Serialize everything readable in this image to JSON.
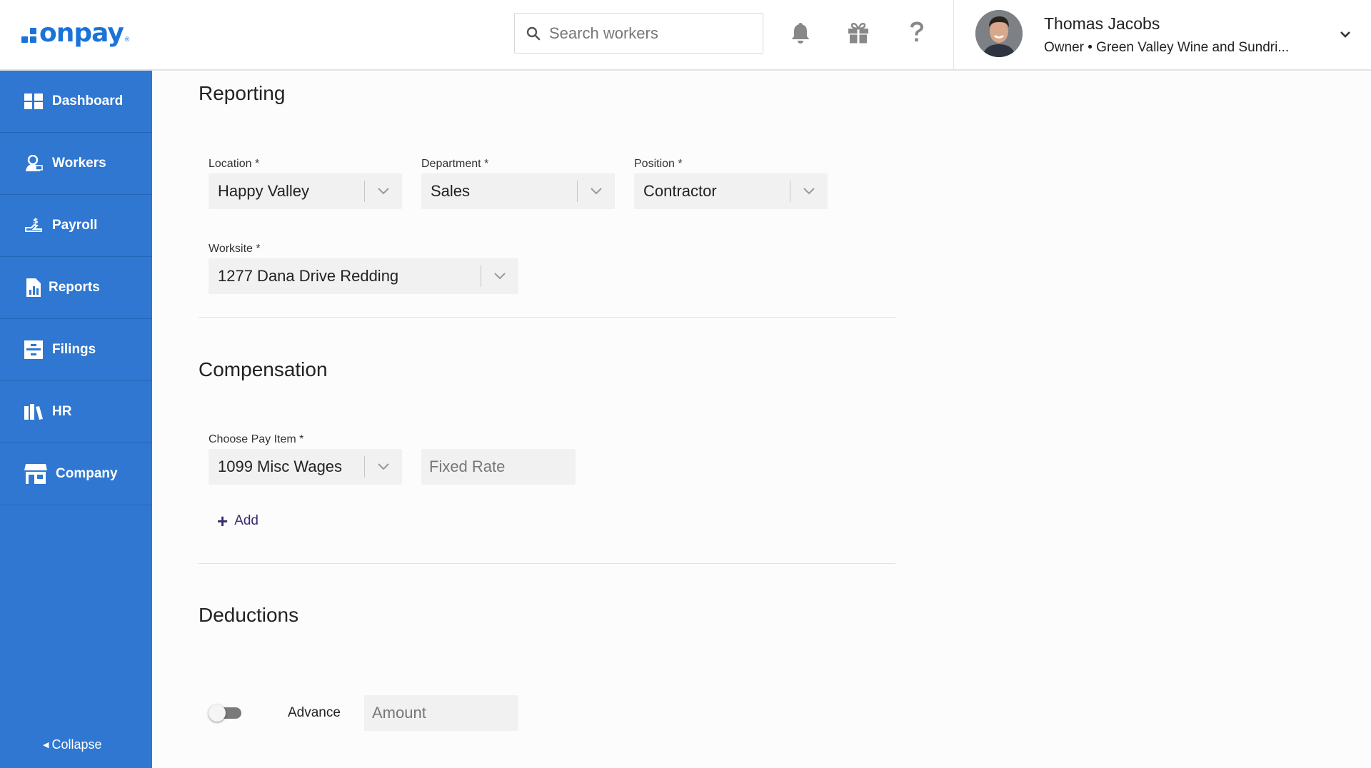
{
  "brand": {
    "logo_text": "onpay",
    "logo_reg": "®",
    "accent": "#2f77d0"
  },
  "search": {
    "placeholder": "Search workers",
    "icon": "search-icon"
  },
  "header_icons": [
    "bell-icon",
    "gift-icon",
    "help-icon"
  ],
  "user": {
    "name": "Thomas Jacobs",
    "subtitle": "Owner • Green Valley Wine and Sundri..."
  },
  "sidebar": {
    "items": [
      {
        "label": "Dashboard",
        "icon": "dashboard-icon"
      },
      {
        "label": "Workers",
        "icon": "workers-icon"
      },
      {
        "label": "Payroll",
        "icon": "payroll-icon"
      },
      {
        "label": "Reports",
        "icon": "reports-icon"
      },
      {
        "label": "Filings",
        "icon": "filings-icon"
      },
      {
        "label": "HR",
        "icon": "hr-icon"
      },
      {
        "label": "Company",
        "icon": "company-icon"
      }
    ],
    "collapse_label": "Collapse"
  },
  "reporting": {
    "title": "Reporting",
    "location": {
      "label": "Location *",
      "value": "Happy Valley"
    },
    "department": {
      "label": "Department *",
      "value": "Sales"
    },
    "position": {
      "label": "Position *",
      "value": "Contractor"
    },
    "worksite": {
      "label": "Worksite *",
      "value": "1277 Dana Drive Redding"
    }
  },
  "compensation": {
    "title": "Compensation",
    "pay_item": {
      "label": "Choose Pay Item *",
      "value": "1099 Misc Wages"
    },
    "rate": {
      "placeholder": "Fixed Rate"
    },
    "add_label": "Add"
  },
  "deductions": {
    "title": "Deductions",
    "toggle": {
      "label": "Advance",
      "on": false
    },
    "amount": {
      "placeholder": "Amount"
    }
  }
}
